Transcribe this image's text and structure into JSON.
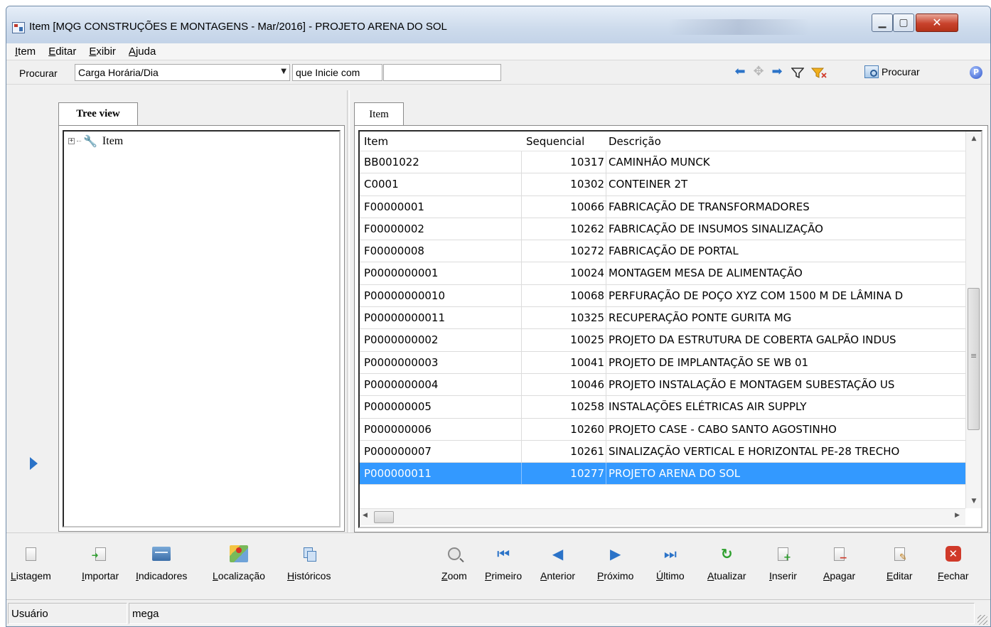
{
  "window": {
    "title": "Item [MQG CONSTRUÇÕES E MONTAGENS - Mar/2016]  - PROJETO ARENA DO SOL",
    "min_glyph": "▁",
    "max_glyph": "▢",
    "close_glyph": "✕"
  },
  "menu": [
    "Item",
    "Editar",
    "Exibir",
    "Ajuda"
  ],
  "search": {
    "label": "Procurar",
    "field": "Carga Horária/Dia",
    "condition": "que Inicie com",
    "value": "",
    "button": "Procurar",
    "help": "P"
  },
  "tree": {
    "tab": "Tree view",
    "root": "Item"
  },
  "grid": {
    "tab": "Item",
    "columns": [
      "Item",
      "Sequencial",
      "Descrição"
    ],
    "rows": [
      {
        "item": "BB001022",
        "seq": "10317",
        "desc": "CAMINHÃO MUNCK"
      },
      {
        "item": "C0001",
        "seq": "10302",
        "desc": "CONTEINER 2T"
      },
      {
        "item": "F00000001",
        "seq": "10066",
        "desc": "FABRICAÇÃO DE TRANSFORMADORES"
      },
      {
        "item": "F00000002",
        "seq": "10262",
        "desc": "FABRICAÇÃO DE INSUMOS SINALIZAÇÃO"
      },
      {
        "item": "F00000008",
        "seq": "10272",
        "desc": "FABRICAÇÃO DE PORTAL"
      },
      {
        "item": "P0000000001",
        "seq": "10024",
        "desc": "MONTAGEM MESA DE ALIMENTAÇÃO"
      },
      {
        "item": "P00000000010",
        "seq": "10068",
        "desc": "PERFURAÇÃO DE POÇO XYZ COM 1500 M DE LÂMINA D"
      },
      {
        "item": "P00000000011",
        "seq": "10325",
        "desc": "RECUPERAÇÃO PONTE GURITA MG"
      },
      {
        "item": "P0000000002",
        "seq": "10025",
        "desc": "PROJETO DA ESTRUTURA DE COBERTA GALPÃO INDUS"
      },
      {
        "item": "P0000000003",
        "seq": "10041",
        "desc": "PROJETO DE IMPLANTAÇÃO SE WB 01"
      },
      {
        "item": "P0000000004",
        "seq": "10046",
        "desc": "PROJETO INSTALAÇÃO E MONTAGEM SUBESTAÇÃO US"
      },
      {
        "item": "P000000005",
        "seq": "10258",
        "desc": "INSTALAÇÕES ELÉTRICAS AIR SUPPLY"
      },
      {
        "item": "P000000006",
        "seq": "10260",
        "desc": "PROJETO CASE - CABO SANTO AGOSTINHO"
      },
      {
        "item": "P000000007",
        "seq": "10261",
        "desc": "SINALIZAÇÃO VERTICAL E HORIZONTAL PE-28 TRECHO"
      },
      {
        "item": "P000000011",
        "seq": "10277",
        "desc": "PROJETO ARENA DO SOL"
      }
    ],
    "selected_index": 14
  },
  "toolbar": {
    "listagem": "Listagem",
    "importar": "Importar",
    "indicadores": "Indicadores",
    "localizacao": "Localização",
    "historicos": "Históricos",
    "zoom": "Zoom",
    "primeiro": "Primeiro",
    "anterior": "Anterior",
    "proximo": "Próximo",
    "ultimo": "Último",
    "atualizar": "Atualizar",
    "inserir": "Inserir",
    "apagar": "Apagar",
    "editar": "Editar",
    "fechar": "Fechar"
  },
  "status": {
    "label": "Usuário",
    "value": "mega"
  },
  "colors": {
    "selection": "#3399ff",
    "accent_blue": "#2b73c8",
    "close_red": "#d03a2a"
  }
}
